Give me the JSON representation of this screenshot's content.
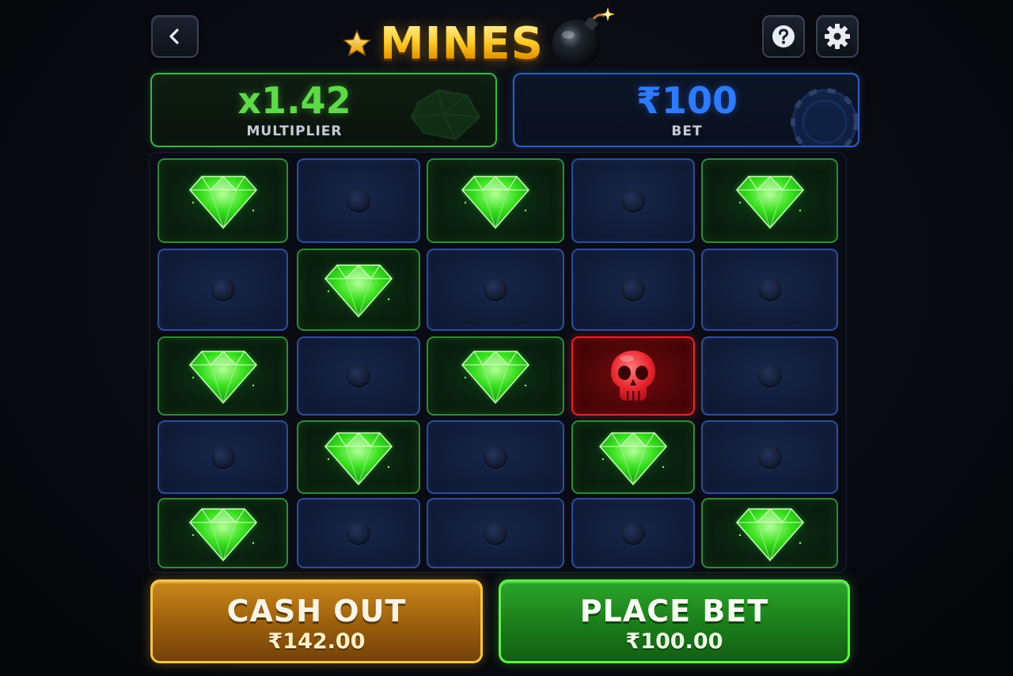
{
  "header": {
    "title": "MINES",
    "back_icon": "chevron-left-icon",
    "help_icon": "question-icon",
    "settings_icon": "gear-icon",
    "title_decor_icons": [
      "star-icon",
      "bomb-icon"
    ]
  },
  "stats": {
    "multiplier": {
      "value": "x1.42",
      "label": "MULTIPLIER",
      "color": "#5fd94a",
      "icon": "gem-icon"
    },
    "bet": {
      "value": "₹100",
      "label": "BET",
      "color": "#2e7bff",
      "icon": "chip-icon"
    }
  },
  "board": {
    "columns": 5,
    "rows": 5,
    "tiles": [
      [
        "gem",
        "hidden",
        "gem",
        "hidden",
        "gem"
      ],
      [
        "hidden",
        "gem",
        "hidden",
        "hidden",
        "hidden"
      ],
      [
        "gem",
        "hidden",
        "gem",
        "mine",
        "hidden"
      ],
      [
        "hidden",
        "gem",
        "hidden",
        "gem",
        "hidden"
      ],
      [
        "gem",
        "hidden",
        "hidden",
        "hidden",
        "gem"
      ]
    ],
    "tile_icons": {
      "gem": "emerald-gem-icon",
      "mine": "skull-icon",
      "hidden": "hidden-tile-dot"
    },
    "colors": {
      "gem": "#2f8a3a",
      "hidden": "#2e4d9a",
      "mine": "#e0262e"
    }
  },
  "actions": {
    "cash_out": {
      "label": "CASH OUT",
      "amount": "₹142.00",
      "color": "#f6c548"
    },
    "place_bet": {
      "label": "PLACE BET",
      "amount": "₹100.00",
      "color": "#5ef24a"
    }
  }
}
